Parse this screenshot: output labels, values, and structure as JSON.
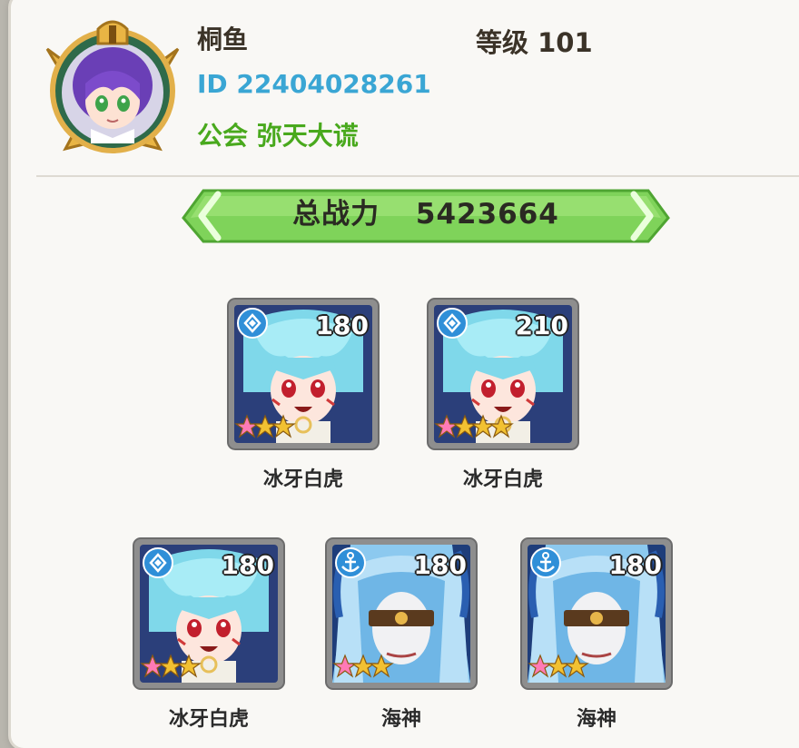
{
  "player": {
    "name": "桐鱼",
    "level_label": "等级 101",
    "id_label": "ID 22404028261",
    "guild_label": "公会 弥天大谎"
  },
  "power": {
    "label": "总战力",
    "value": "5423664"
  },
  "heroes": [
    {
      "name": "冰牙白虎",
      "level": "180",
      "stars": 3,
      "class_icon": "shield-class-icon",
      "portrait": "white-tiger"
    },
    {
      "name": "冰牙白虎",
      "level": "210",
      "stars": 4,
      "class_icon": "shield-class-icon",
      "portrait": "white-tiger"
    },
    {
      "name": "冰牙白虎",
      "level": "180",
      "stars": 3,
      "class_icon": "shield-class-icon",
      "portrait": "white-tiger"
    },
    {
      "name": "海神",
      "level": "180",
      "stars": 3,
      "class_icon": "anchor-class-icon",
      "portrait": "sea-god"
    },
    {
      "name": "海神",
      "level": "180",
      "stars": 3,
      "class_icon": "anchor-class-icon",
      "portrait": "sea-god"
    }
  ],
  "colors": {
    "id_text": "#3aa6d4",
    "guild_text": "#49a91d",
    "power_banner": "#7fd35a",
    "class_badge": "#2f8fd8"
  }
}
